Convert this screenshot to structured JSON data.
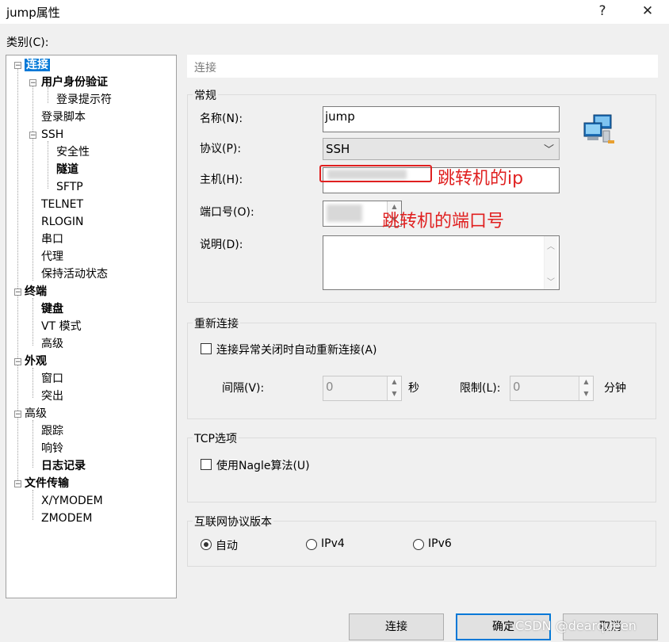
{
  "window": {
    "title": "jump属性",
    "help_glyph": "?",
    "close_glyph": "✕"
  },
  "category_label": "类别(C):",
  "tree": [
    {
      "label": "连接",
      "bold": true,
      "selected": true
    },
    {
      "label": "用户身份验证",
      "bold": true
    },
    {
      "label": "登录提示符"
    },
    {
      "label": "登录脚本"
    },
    {
      "label": "SSH"
    },
    {
      "label": "安全性"
    },
    {
      "label": "隧道",
      "bold": true
    },
    {
      "label": "SFTP"
    },
    {
      "label": "TELNET"
    },
    {
      "label": "RLOGIN"
    },
    {
      "label": "串口"
    },
    {
      "label": "代理"
    },
    {
      "label": "保持活动状态"
    },
    {
      "label": "终端",
      "bold": true
    },
    {
      "label": "键盘",
      "bold": true
    },
    {
      "label": "VT 模式"
    },
    {
      "label": "高级"
    },
    {
      "label": "外观",
      "bold": true
    },
    {
      "label": "窗口"
    },
    {
      "label": "突出"
    },
    {
      "label": "高级"
    },
    {
      "label": "跟踪"
    },
    {
      "label": "响铃"
    },
    {
      "label": "日志记录",
      "bold": true
    },
    {
      "label": "文件传输",
      "bold": true
    },
    {
      "label": "X/YMODEM"
    },
    {
      "label": "ZMODEM"
    }
  ],
  "header": "连接",
  "general": {
    "title": "常规",
    "name_label": "名称(N):",
    "name_value": "jump",
    "protocol_label": "协议(P):",
    "protocol_value": "SSH",
    "host_label": "主机(H):",
    "port_label": "端口号(O):",
    "desc_label": "说明(D):"
  },
  "reconnect": {
    "title": "重新连接",
    "auto_label": "连接异常关闭时自动重新连接(A)",
    "interval_label": "间隔(V):",
    "interval_value": "0",
    "interval_unit": "秒",
    "limit_label": "限制(L):",
    "limit_value": "0",
    "limit_unit": "分钟"
  },
  "tcp": {
    "title": "TCP选项",
    "nagle_label": "使用Nagle算法(U)"
  },
  "ipver": {
    "title": "互联网协议版本",
    "opt_auto": "自动",
    "opt_v4": "IPv4",
    "opt_v6": "IPv6",
    "selected": "auto"
  },
  "buttons": {
    "connect": "连接",
    "ok": "确定",
    "cancel": "取消"
  },
  "annotations": {
    "host_note": "跳转机的ip",
    "port_note": "跳转机的端口号"
  },
  "watermark": "CSDN @dearqueen",
  "colors": {
    "selection": "#0078d7",
    "annotation": "#e02020"
  }
}
